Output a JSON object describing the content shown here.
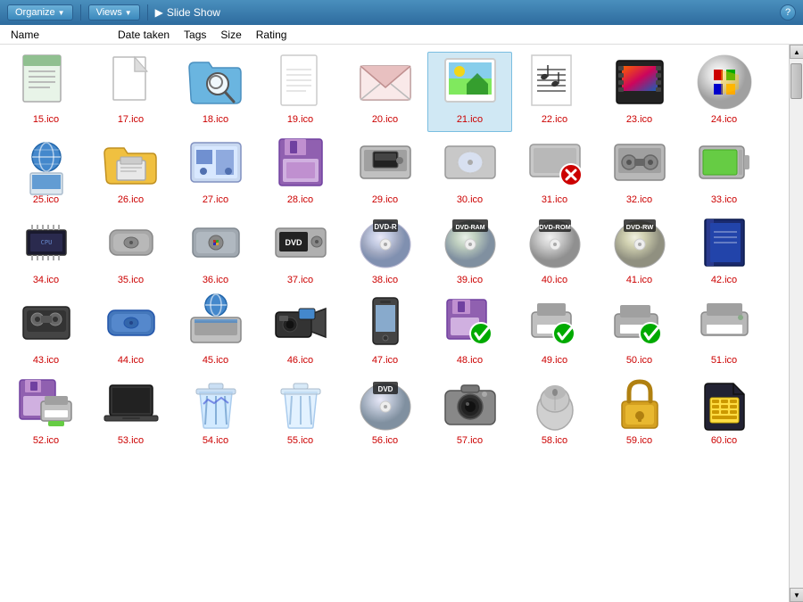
{
  "titlebar": {
    "organize_label": "Organize",
    "views_label": "Views",
    "slideshow_label": "Slide Show",
    "help_label": "?"
  },
  "columns": {
    "name": "Name",
    "date_taken": "Date taken",
    "tags": "Tags",
    "size": "Size",
    "rating": "Rating"
  },
  "files": [
    {
      "id": "15",
      "label": "15.ico",
      "type": "document-preview"
    },
    {
      "id": "17",
      "label": "17.ico",
      "type": "blank-page"
    },
    {
      "id": "18",
      "label": "18.ico",
      "type": "folder-search"
    },
    {
      "id": "19",
      "label": "19.ico",
      "type": "blank-document"
    },
    {
      "id": "20",
      "label": "20.ico",
      "type": "envelope"
    },
    {
      "id": "21",
      "label": "21.ico",
      "type": "photo-frame",
      "selected": true
    },
    {
      "id": "22",
      "label": "22.ico",
      "type": "sheet-music"
    },
    {
      "id": "23",
      "label": "23.ico",
      "type": "film-strip"
    },
    {
      "id": "24",
      "label": "24.ico",
      "type": "windows-logo"
    },
    {
      "id": "25",
      "label": "25.ico",
      "type": "network-computer"
    },
    {
      "id": "26",
      "label": "26.ico",
      "type": "folder-printer"
    },
    {
      "id": "27",
      "label": "27.ico",
      "type": "network-drive"
    },
    {
      "id": "28",
      "label": "28.ico",
      "type": "floppy-purple"
    },
    {
      "id": "29",
      "label": "29.ico",
      "type": "floppy-drive"
    },
    {
      "id": "30",
      "label": "30.ico",
      "type": "cd-drive"
    },
    {
      "id": "31",
      "label": "31.ico",
      "type": "drive-error"
    },
    {
      "id": "32",
      "label": "32.ico",
      "type": "tape-drive"
    },
    {
      "id": "33",
      "label": "33.ico",
      "type": "battery-drive"
    },
    {
      "id": "34",
      "label": "34.ico",
      "type": "chip"
    },
    {
      "id": "35",
      "label": "35.ico",
      "type": "external-drive"
    },
    {
      "id": "36",
      "label": "36.ico",
      "type": "windows-drive"
    },
    {
      "id": "37",
      "label": "37.ico",
      "type": "dvd-drive"
    },
    {
      "id": "38",
      "label": "38.ico",
      "type": "dvd-r"
    },
    {
      "id": "39",
      "label": "39.ico",
      "type": "dvd-ram"
    },
    {
      "id": "40",
      "label": "40.ico",
      "type": "dvd-rom"
    },
    {
      "id": "41",
      "label": "41.ico",
      "type": "dvd-rw"
    },
    {
      "id": "42",
      "label": "42.ico",
      "type": "book-blue"
    },
    {
      "id": "43",
      "label": "43.ico",
      "type": "tape-cassette"
    },
    {
      "id": "44",
      "label": "44.ico",
      "type": "external-blue"
    },
    {
      "id": "45",
      "label": "45.ico",
      "type": "scanner-globe"
    },
    {
      "id": "46",
      "label": "46.ico",
      "type": "camcorder"
    },
    {
      "id": "47",
      "label": "47.ico",
      "type": "mobile-phone"
    },
    {
      "id": "48",
      "label": "48.ico",
      "type": "floppy-check"
    },
    {
      "id": "49",
      "label": "49.ico",
      "type": "printer-check"
    },
    {
      "id": "50",
      "label": "50.ico",
      "type": "printer-check2"
    },
    {
      "id": "51",
      "label": "51.ico",
      "type": "printer-plain"
    },
    {
      "id": "52",
      "label": "52.ico",
      "type": "floppy-printer"
    },
    {
      "id": "53",
      "label": "53.ico",
      "type": "laptop-dark"
    },
    {
      "id": "54",
      "label": "54.ico",
      "type": "recycle-bin-full"
    },
    {
      "id": "55",
      "label": "55.ico",
      "type": "recycle-bin-empty"
    },
    {
      "id": "56",
      "label": "56.ico",
      "type": "dvd-disc"
    },
    {
      "id": "57",
      "label": "57.ico",
      "type": "camera"
    },
    {
      "id": "58",
      "label": "58.ico",
      "type": "mouse-device"
    },
    {
      "id": "59",
      "label": "59.ico",
      "type": "padlock"
    },
    {
      "id": "60",
      "label": "60.ico",
      "type": "sim-card"
    }
  ]
}
